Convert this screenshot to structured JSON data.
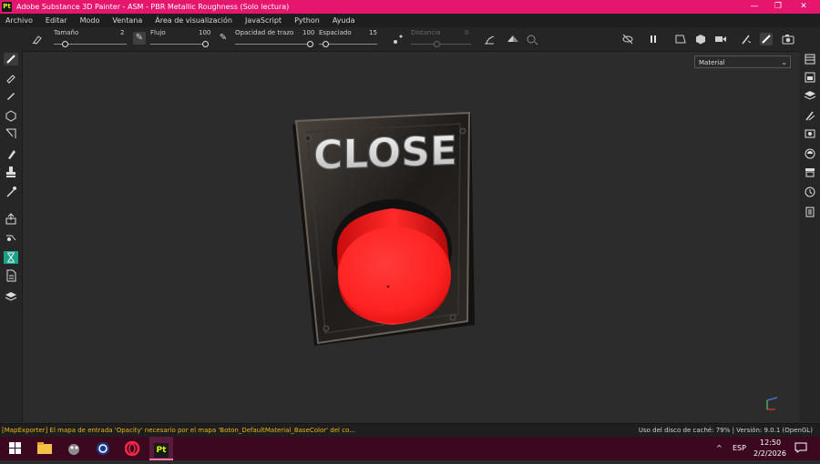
{
  "window": {
    "app_icon": "Pt",
    "title": "Adobe Substance 3D Painter - ASM - PBR Metallic Roughness (Solo lectura)",
    "controls": [
      "—",
      "❐",
      "✕"
    ]
  },
  "menu": [
    "Archivo",
    "Editar",
    "Modo",
    "Ventana",
    "Área de visualización",
    "JavaScript",
    "Python",
    "Ayuda"
  ],
  "toolbar": {
    "tamano_label": "Tamaño",
    "tamano_value": "2",
    "flujo_label": "Flujo",
    "flujo_value": "100",
    "opacidad_label": "Opacidad de trazo",
    "opacidad_value": "100",
    "espaciado_label": "Espaciado",
    "espaciado_value": "15",
    "distancia_label": "Distancia",
    "distancia_value": "0"
  },
  "viewport": {
    "material_select": "Material",
    "button_label": "CLOSE"
  },
  "status": {
    "message": "[MapExporter] El mapa de entrada 'Opacity' necesario por el mapa 'Boton_DefaultMaterial_BaseColor' del co...",
    "cache": "Uso del disco de caché:   79%  |  Versión: 9.0.1 (OpenGL)"
  },
  "taskbar": {
    "language": "ESP",
    "time": "12:50",
    "date": "2/2/2026",
    "pt_label": "Pt",
    "tray_chevron": "^"
  },
  "colors": {
    "title_bar": "#e6166f",
    "accent_green": "#1aa188",
    "warning_text": "#f0b414",
    "button_red": "#ff2424",
    "taskbar": "#3b0820"
  }
}
